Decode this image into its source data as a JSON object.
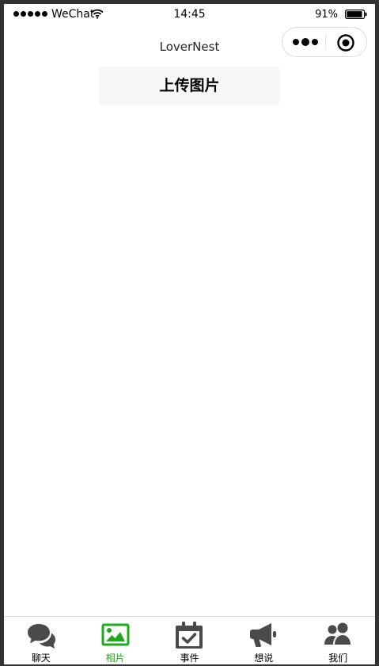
{
  "status_bar": {
    "carrier": "WeChat",
    "time": "14:45",
    "battery": "91%",
    "battery_level": 0.91,
    "signal_bars": 5
  },
  "nav": {
    "title": "LoverNest"
  },
  "main": {
    "upload_label": "上传图片"
  },
  "tab_bar": {
    "active_color": "#1aad19",
    "inactive_color": "#4a4a4a",
    "active_index": 1,
    "items": [
      {
        "label": "聊天",
        "icon": "chat-bubbles-icon"
      },
      {
        "label": "相片",
        "icon": "image-icon"
      },
      {
        "label": "事件",
        "icon": "calendar-check-icon"
      },
      {
        "label": "想说",
        "icon": "megaphone-icon"
      },
      {
        "label": "我们",
        "icon": "users-icon"
      }
    ]
  }
}
